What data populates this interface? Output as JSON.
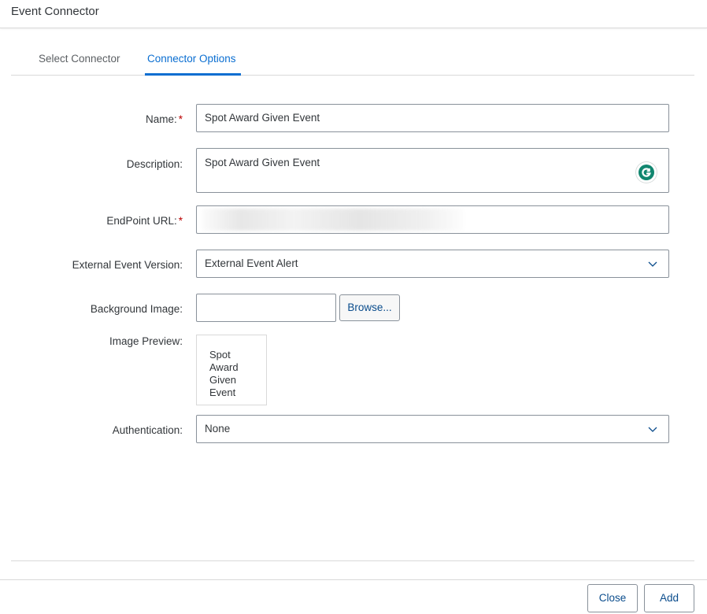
{
  "header": {
    "title": "Event Connector"
  },
  "tabs": [
    {
      "label": "Select Connector",
      "active": false
    },
    {
      "label": "Connector Options",
      "active": true
    }
  ],
  "form": {
    "name": {
      "label": "Name:",
      "value": "Spot Award Given Event",
      "required": "*"
    },
    "description": {
      "label": "Description:",
      "value": "Spot Award Given Event"
    },
    "endpoint_url": {
      "label": "EndPoint URL:",
      "value": "",
      "required": "*"
    },
    "external_event_version": {
      "label": "External Event Version:",
      "value": "External Event Alert"
    },
    "background_image": {
      "label": "Background Image:",
      "value": "",
      "browse_label": "Browse..."
    },
    "image_preview": {
      "label": "Image Preview:",
      "text": "Spot Award Given Event"
    },
    "authentication": {
      "label": "Authentication:",
      "value": "None"
    }
  },
  "footer": {
    "close_label": "Close",
    "add_label": "Add"
  },
  "colors": {
    "accent": "#0a6ed1",
    "required": "#bb0000",
    "button_text": "#0a4c8c",
    "grammarly": "#15c39a"
  },
  "icons": {
    "dropdown": "chevron-down-icon",
    "grammarly": "grammarly-icon"
  }
}
